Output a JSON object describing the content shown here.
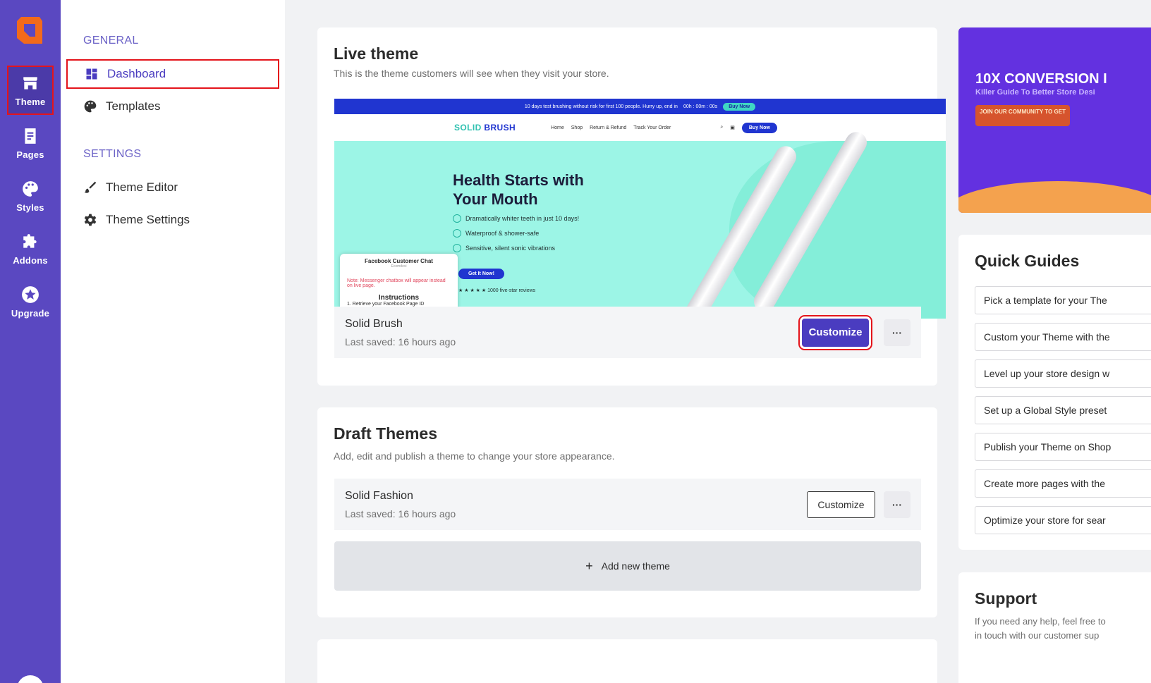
{
  "rail": {
    "items": [
      {
        "label": "Theme",
        "icon": "store-icon",
        "active": true
      },
      {
        "label": "Pages",
        "icon": "page-icon"
      },
      {
        "label": "Styles",
        "icon": "palette-icon"
      },
      {
        "label": "Addons",
        "icon": "puzzle-icon"
      },
      {
        "label": "Upgrade",
        "icon": "star-icon"
      }
    ]
  },
  "subnav": {
    "general_label": "GENERAL",
    "settings_label": "SETTINGS",
    "items": [
      {
        "label": "Dashboard",
        "icon": "dashboard-icon",
        "active": true
      },
      {
        "label": "Templates",
        "icon": "palette-icon"
      },
      {
        "label": "Theme Editor",
        "icon": "brush-icon"
      },
      {
        "label": "Theme Settings",
        "icon": "gear-icon"
      }
    ]
  },
  "live": {
    "title": "Live theme",
    "subtitle": "This is the theme customers will see when they visit your store.",
    "theme_name": "Solid Brush",
    "last_saved": "Last saved: 16 hours ago",
    "customize_label": "Customize",
    "more_label": "···",
    "preview": {
      "topbar_text": "10 days test brushing without risk for first 100 people. Hurry up, end in",
      "countdown": "00h : 00m : 00s",
      "topbar_button": "Buy Now",
      "brand_a": "SOLID",
      "brand_b": "BRUSH",
      "nav": [
        "Home",
        "Shop",
        "Return & Refund",
        "Track Your Order"
      ],
      "header_button": "Buy Now",
      "headline_1": "Health Starts with",
      "headline_2": "Your Mouth",
      "bullets": [
        "Dramatically whiter teeth in just 10 days!",
        "Waterproof & shower-safe",
        "Sensitive, silent sonic vibrations"
      ],
      "cta": "Get It Now!",
      "reviews": "★ ★ ★ ★ ★  1000 five-star reviews",
      "chat_title": "Facebook Customer Chat",
      "chat_sub": "Ecomdevi",
      "chat_warning": "Note: Messenger chatbox will appear instead on live page.",
      "chat_instructions": "Instructions",
      "chat_step": "1. Retrieve your Facebook Page ID"
    }
  },
  "drafts": {
    "title": "Draft Themes",
    "subtitle": "Add, edit and publish a theme to change your store appearance.",
    "theme_name": "Solid Fashion",
    "last_saved": "Last saved: 16 hours ago",
    "customize_label": "Customize",
    "more_label": "···",
    "add_label": "Add new theme",
    "add_icon": "+"
  },
  "promo": {
    "headline": "10X CONVERSION I",
    "subline": "Killer Guide To Better Store Desi",
    "cta": "JOIN OUR COMMUNITY TO GET"
  },
  "quick_guides": {
    "title": "Quick Guides",
    "items": [
      "Pick a template for your The",
      "Custom your Theme with the",
      "Level up your store design w",
      "Set up a Global Style preset",
      "Publish your Theme on Shop",
      "Create more pages with the",
      "Optimize your store for sear"
    ]
  },
  "support": {
    "title": "Support",
    "line1": "If you need any help, feel free to",
    "line2": "in touch with our customer sup"
  },
  "colors": {
    "rail": "#5a48c1",
    "accent": "#4a3cc0",
    "highlight": "#e4141b",
    "logo": "#f26a1b"
  }
}
